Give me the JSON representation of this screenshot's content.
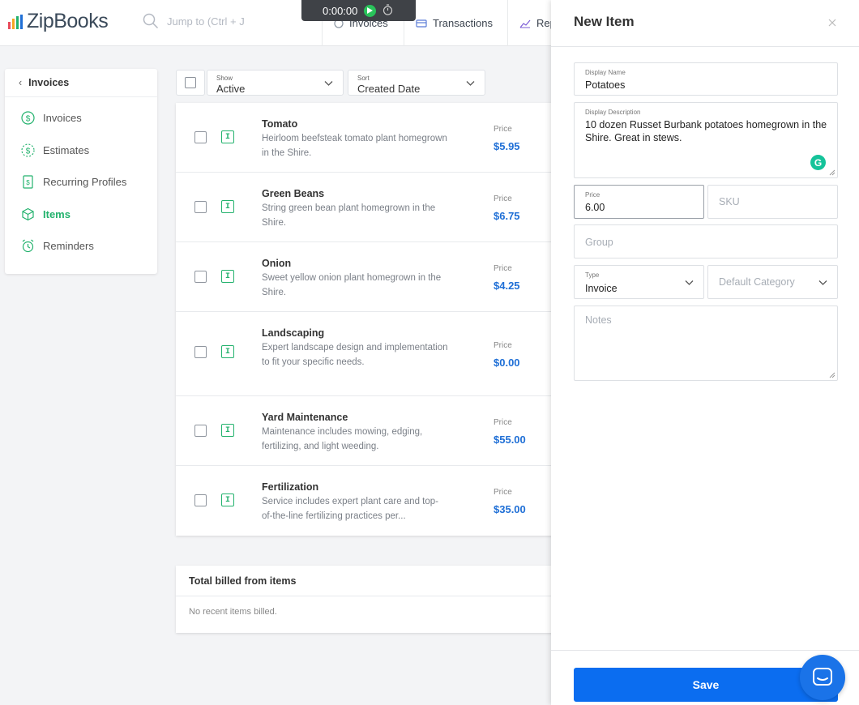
{
  "app": {
    "logo_text": "ZipBooks",
    "logo_colors": [
      "#e84b5b",
      "#f5a623",
      "#23b26d",
      "#1f6fd6",
      "#7b5cd6"
    ]
  },
  "topbar": {
    "search_placeholder": "Jump to (Ctrl + J",
    "timer": "0:00:00",
    "nav": [
      {
        "label": "Invoices",
        "icon": "invoice-icon"
      },
      {
        "label": "Transactions",
        "icon": "transactions-icon"
      },
      {
        "label": "Rep",
        "icon": "reports-icon"
      }
    ]
  },
  "sidebar": {
    "back_label": "Invoices",
    "items": [
      {
        "label": "Invoices",
        "icon": "dollar-circle-icon",
        "active": false
      },
      {
        "label": "Estimates",
        "icon": "dollar-dashed-icon",
        "active": false
      },
      {
        "label": "Recurring Profiles",
        "icon": "recurring-doc-icon",
        "active": false
      },
      {
        "label": "Items",
        "icon": "box-icon",
        "active": true
      },
      {
        "label": "Reminders",
        "icon": "alarm-clock-icon",
        "active": false
      }
    ]
  },
  "filters": {
    "show": {
      "label": "Show",
      "value": "Active"
    },
    "sort": {
      "label": "Sort",
      "value": "Created Date"
    }
  },
  "items": [
    {
      "name": "Tomato",
      "desc": "Heirloom beefsteak tomato plant homegrown in the Shire.",
      "price_label": "Price",
      "price": "$5.95"
    },
    {
      "name": "Green Beans",
      "desc": "String green bean plant homegrown in the Shire.",
      "price_label": "Price",
      "price": "$6.75"
    },
    {
      "name": "Onion",
      "desc": "Sweet yellow onion plant homegrown in the Shire.",
      "price_label": "Price",
      "price": "$4.25"
    },
    {
      "name": "Landscaping",
      "desc": "Expert landscape design and implementation to fit your specific needs.",
      "price_label": "Price",
      "price": "$0.00"
    },
    {
      "name": "Yard Maintenance",
      "desc": "Maintenance includes mowing, edging, fertilizing, and light weeding.",
      "price_label": "Price",
      "price": "$55.00"
    },
    {
      "name": "Fertilization",
      "desc": "Service includes expert plant care and top-of-the-line fertilizing practices per...",
      "price_label": "Price",
      "price": "$35.00"
    }
  ],
  "billed": {
    "title": "Total billed from items",
    "empty": "No recent items billed."
  },
  "panel": {
    "title": "New Item",
    "display_name": {
      "label": "Display Name",
      "value": "Potatoes"
    },
    "display_description": {
      "label": "Display Description",
      "value": "10 dozen Russet Burbank potatoes homegrown in the Shire. Great in stews."
    },
    "price": {
      "label": "Price",
      "value": "6.00"
    },
    "sku_placeholder": "SKU",
    "group_placeholder": "Group",
    "type": {
      "label": "Type",
      "value": "Invoice"
    },
    "category_placeholder": "Default Category",
    "notes_placeholder": "Notes",
    "save_label": "Save"
  }
}
